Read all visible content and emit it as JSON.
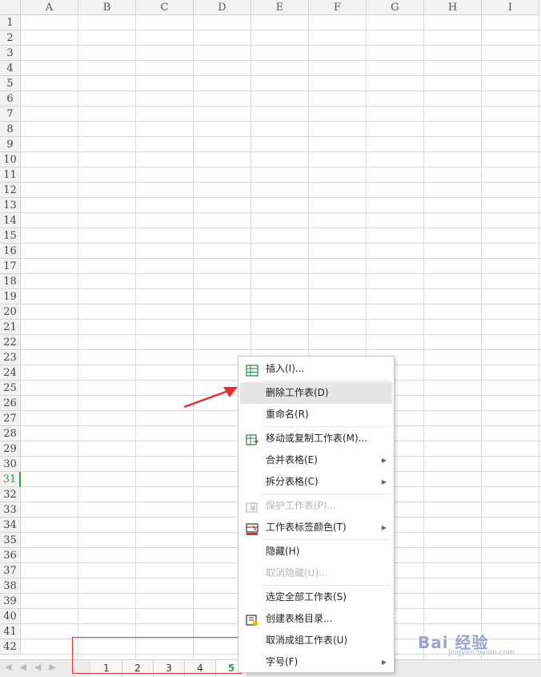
{
  "columns": [
    "A",
    "B",
    "C",
    "D",
    "E",
    "F",
    "G",
    "H",
    "I"
  ],
  "rows": [
    "1",
    "2",
    "3",
    "4",
    "5",
    "6",
    "7",
    "8",
    "9",
    "10",
    "11",
    "12",
    "13",
    "14",
    "15",
    "16",
    "17",
    "18",
    "19",
    "20",
    "21",
    "22",
    "23",
    "24",
    "25",
    "26",
    "27",
    "28",
    "29",
    "30",
    "31",
    "32",
    "33",
    "34",
    "35",
    "36",
    "37",
    "38",
    "39",
    "40",
    "41",
    "42"
  ],
  "active_row": "31",
  "sheet_tabs": [
    "1",
    "2",
    "3",
    "4",
    "5"
  ],
  "active_tab": "5",
  "context_menu": {
    "items": [
      {
        "label": "插入(I)...",
        "icon": "insert-sheet-icon",
        "state": "normal"
      },
      {
        "label": "删除工作表(D)",
        "icon": "",
        "state": "hover"
      },
      {
        "label": "重命名(R)",
        "icon": "",
        "state": "normal"
      },
      {
        "label": "移动或复制工作表(M)...",
        "icon": "move-copy-sheet-icon",
        "state": "normal"
      },
      {
        "label": "合并表格(E)",
        "icon": "",
        "state": "normal",
        "submenu": true
      },
      {
        "label": "拆分表格(C)",
        "icon": "",
        "state": "normal",
        "submenu": true
      },
      {
        "label": "保护工作表(P)...",
        "icon": "protect-sheet-icon",
        "state": "disabled"
      },
      {
        "label": "工作表标签颜色(T)",
        "icon": "tab-color-icon",
        "state": "normal",
        "submenu": true
      },
      {
        "label": "隐藏(H)",
        "icon": "",
        "state": "normal"
      },
      {
        "label": "取消隐藏(U)...",
        "icon": "",
        "state": "disabled"
      },
      {
        "label": "选定全部工作表(S)",
        "icon": "",
        "state": "normal"
      },
      {
        "label": "创建表格目录...",
        "icon": "create-directory-icon",
        "state": "normal"
      },
      {
        "label": "取消成组工作表(U)",
        "icon": "",
        "state": "normal"
      },
      {
        "label": "字号(F)",
        "icon": "",
        "state": "normal",
        "submenu": true
      }
    ]
  },
  "colors": {
    "accent": "#2e9c45",
    "annotation": "#e03030"
  },
  "watermark": {
    "text": "Bai 经验",
    "sub": "jingyan.baidu.com"
  }
}
